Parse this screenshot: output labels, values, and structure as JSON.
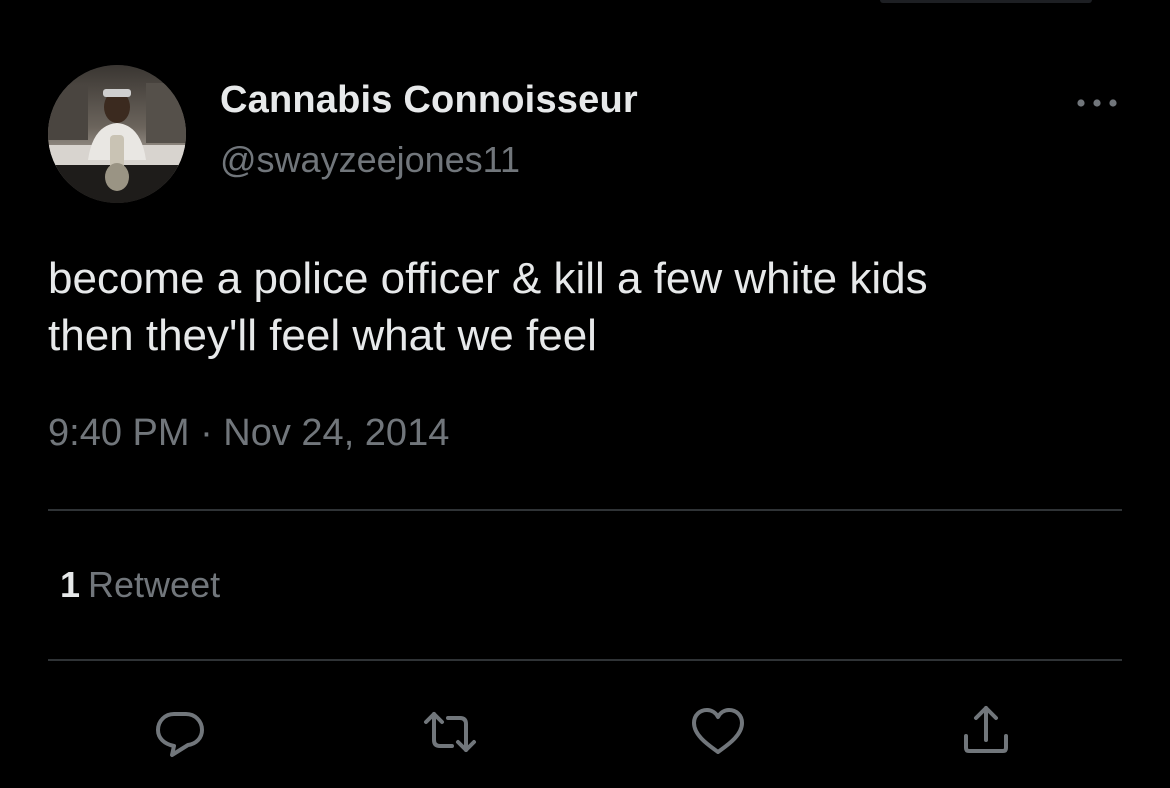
{
  "tweet": {
    "author": {
      "display_name": "Cannabis Connoisseur",
      "handle": "@swayzeejones11",
      "avatar_icon": "user-avatar-photo"
    },
    "text_line1": "become a police officer & kill a few white kids",
    "text_line2": "then they'll feel what we feel",
    "timestamp": "9:40 PM · Nov 24, 2014",
    "stats": {
      "retweet_count": "1",
      "retweet_label": "Retweet"
    },
    "actions": [
      {
        "name": "reply",
        "icon": "reply-icon"
      },
      {
        "name": "retweet",
        "icon": "retweet-icon"
      },
      {
        "name": "like",
        "icon": "heart-icon"
      },
      {
        "name": "share",
        "icon": "share-icon"
      }
    ],
    "more_icon": "more-options-icon"
  },
  "colors": {
    "background": "#000000",
    "text_primary": "#e7e9ea",
    "text_secondary": "#71767b",
    "divider": "#2f3336"
  }
}
